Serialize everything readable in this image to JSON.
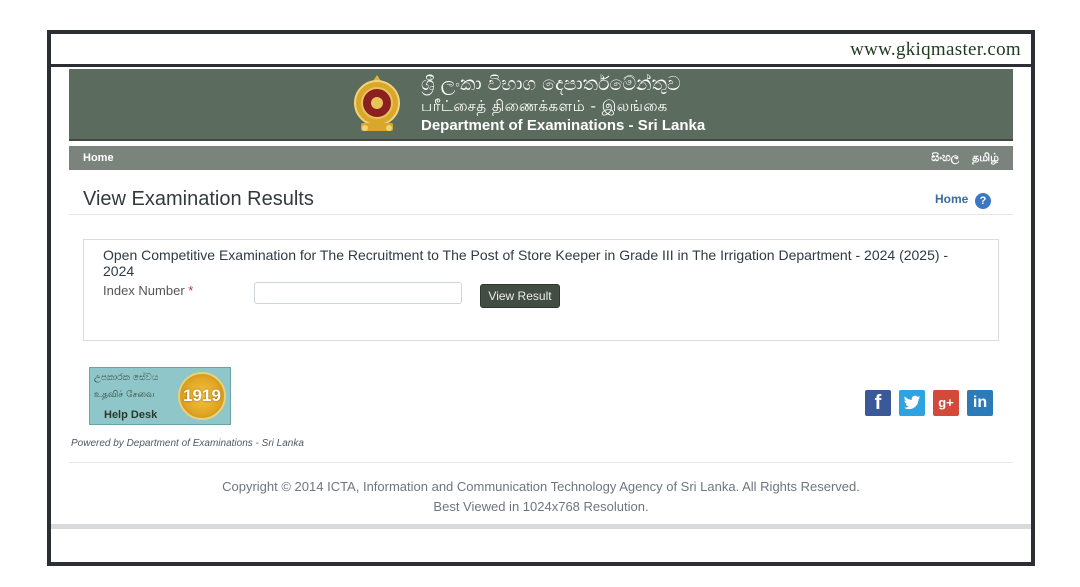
{
  "watermark": "www.gkiqmaster.com",
  "header": {
    "title_sinhala": "ශ්‍රී ලංකා විභාග දෙපාර්තමේන්තුව",
    "title_tamil": "பரீட்சைத் திணைக்களம் - இலங்கை",
    "title_english": "Department of Examinations - Sri Lanka"
  },
  "nav": {
    "home": "Home",
    "lang_sinhala": "සිංහල",
    "lang_tamil": "தமிழ்"
  },
  "page": {
    "title": "View Examination Results",
    "home_link": "Home",
    "help_symbol": "?"
  },
  "exam": {
    "title": "Open Competitive Examination for The Recruitment to The Post of Store Keeper in Grade III in The Irrigation Department - 2024 (2025) - 2024",
    "index_label": "Index Number",
    "required_mark": "*",
    "index_value": "",
    "button_label": "View Result"
  },
  "helpdesk": {
    "line_sinhala": "උපකාරක සේවය",
    "line_tamil": "உதவிச் சேவை",
    "title": "Help Desk",
    "number": "1919"
  },
  "social": {
    "facebook": "f",
    "twitter": "t",
    "googleplus": "g+",
    "linkedin": "in"
  },
  "footer": {
    "powered_by": "Powered by Department of Examinations - Sri Lanka",
    "copyright": "Copyright © 2014 ICTA, Information and Communication Technology Agency of Sri Lanka. All Rights Reserved.",
    "best_viewed": "Best Viewed in 1024x768 Resolution."
  },
  "colors": {
    "header_bg": "#5b6b5e",
    "navbar_bg": "#7b847c",
    "button_bg": "#424d43",
    "link": "#3a6aa6"
  }
}
